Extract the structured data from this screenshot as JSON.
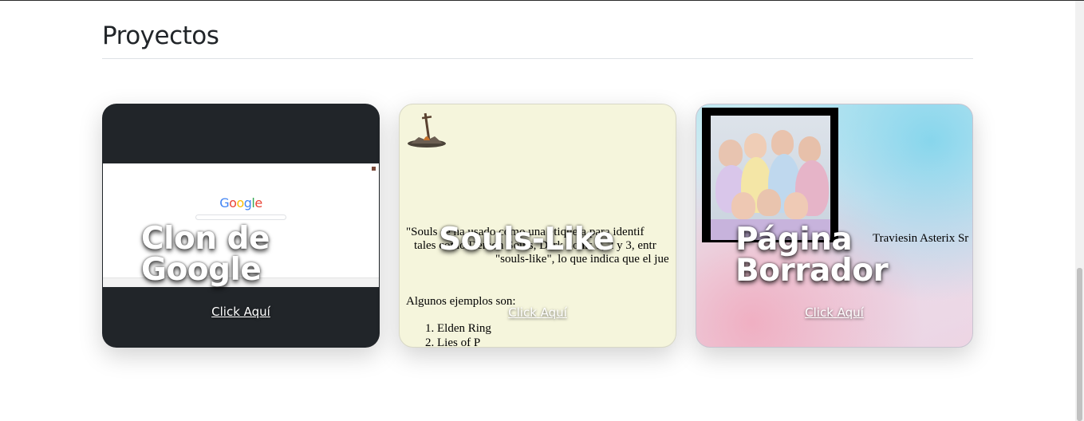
{
  "section": {
    "title": "Proyectos"
  },
  "cards": [
    {
      "title_line1": "Clon de",
      "title_line2": "Google",
      "link": "Click Aquí",
      "preview": {
        "logo": "Google"
      }
    },
    {
      "title": "Souls-Like",
      "link": "Click Aquí",
      "preview": {
        "line1": "\"Souls se ha usado como una etiqueta para identif",
        "line2": "tales como Demon Souls, Dark Souls 1, 2 y 3, entr",
        "line3": "\"souls-like\", lo que indica que el jue",
        "examples_label": "Algunos ejemplos son:",
        "examples": [
          "1. Elden Ring",
          "2. Lies of P"
        ],
        "icon": "bonfire-sword-icon"
      }
    },
    {
      "title_line1": "Página",
      "title_line2": "Borrador",
      "link": "Click Aquí",
      "preview": {
        "side_text": "Traviesin Asterix Sr"
      }
    }
  ],
  "colors": {
    "dark_card": "#212529",
    "souls_bg": "#f5f5dc",
    "title_text": "#212529"
  }
}
